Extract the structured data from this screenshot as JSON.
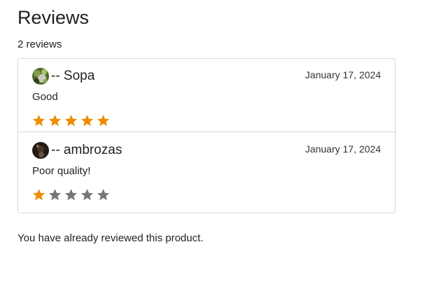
{
  "section": {
    "title": "Reviews",
    "count_text": "2 reviews"
  },
  "colors": {
    "star_filled": "#f08c00",
    "star_empty": "#777777",
    "border": "#d9d9d9"
  },
  "reviews": [
    {
      "author": "-- Sopa",
      "date": "January 17, 2024",
      "text": "Good",
      "rating": 5,
      "max_rating": 5,
      "avatar_icon": "green-photo-avatar"
    },
    {
      "author": "-- ambrozas",
      "date": "January 17, 2024",
      "text": "Poor quality!",
      "rating": 1,
      "max_rating": 5,
      "avatar_icon": "dark-photo-avatar"
    }
  ],
  "notice": "You have already reviewed this product."
}
